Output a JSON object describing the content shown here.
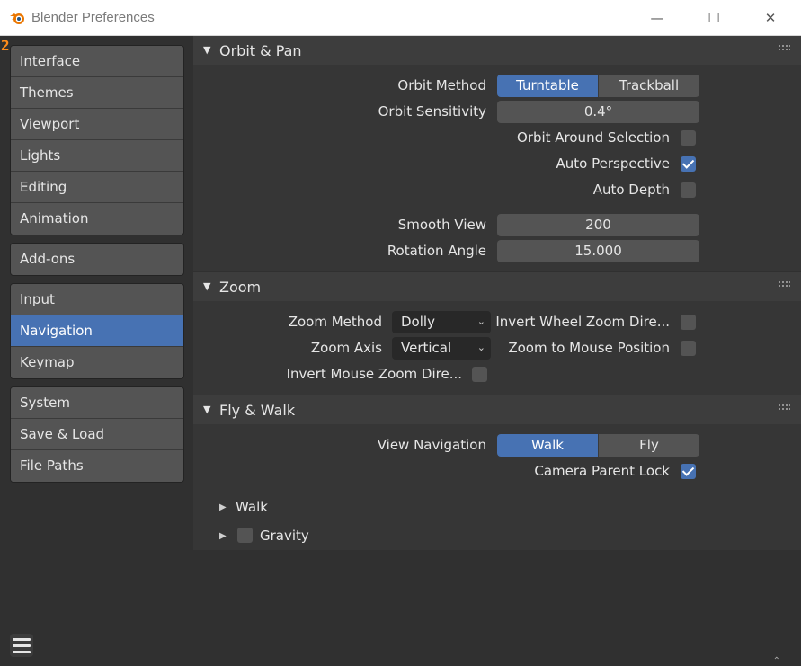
{
  "window": {
    "title": "Blender Preferences",
    "app_icon": "blender-logo-icon",
    "controls": {
      "minimize": "—",
      "maximize": "☐",
      "close": "✕"
    }
  },
  "sidebar": {
    "badge": "2",
    "groups": [
      [
        "Interface",
        "Themes",
        "Viewport",
        "Lights",
        "Editing",
        "Animation"
      ],
      [
        "Add-ons"
      ],
      [
        "Input",
        "Navigation",
        "Keymap"
      ],
      [
        "System",
        "Save & Load",
        "File Paths"
      ]
    ],
    "active": "Navigation",
    "menu_icon": "hamburger-menu-icon"
  },
  "orbit_pan": {
    "title": "Orbit & Pan",
    "orbit_method": {
      "label": "Orbit Method",
      "options": [
        "Turntable",
        "Trackball"
      ],
      "selected": "Turntable"
    },
    "orbit_sensitivity": {
      "label": "Orbit Sensitivity",
      "value": "0.4°"
    },
    "orbit_around_selection": {
      "label": "Orbit Around Selection",
      "checked": false
    },
    "auto_perspective": {
      "label": "Auto Perspective",
      "checked": true
    },
    "auto_depth": {
      "label": "Auto Depth",
      "checked": false
    },
    "smooth_view": {
      "label": "Smooth View",
      "value": "200"
    },
    "rotation_angle": {
      "label": "Rotation Angle",
      "value": "15.000"
    }
  },
  "zoom": {
    "title": "Zoom",
    "zoom_method": {
      "label": "Zoom Method",
      "value": "Dolly"
    },
    "zoom_axis": {
      "label": "Zoom Axis",
      "value": "Vertical"
    },
    "invert_mouse_zoom": {
      "label": "Invert Mouse Zoom Dire...",
      "checked": false
    },
    "invert_wheel_zoom": {
      "label": "Invert Wheel Zoom Dire...",
      "checked": false
    },
    "zoom_to_mouse": {
      "label": "Zoom to Mouse Position",
      "checked": false
    }
  },
  "fly_walk": {
    "title": "Fly & Walk",
    "view_navigation": {
      "label": "View Navigation",
      "options": [
        "Walk",
        "Fly"
      ],
      "selected": "Walk"
    },
    "camera_parent_lock": {
      "label": "Camera Parent Lock",
      "checked": true
    },
    "walk_label": "Walk",
    "gravity": {
      "label": "Gravity",
      "checked": false
    }
  },
  "colors": {
    "accent": "#4772b3",
    "widget": "#545454",
    "panel_body": "#363636",
    "panel_header": "#3d3d3d",
    "badge": "#ff8c1a"
  }
}
